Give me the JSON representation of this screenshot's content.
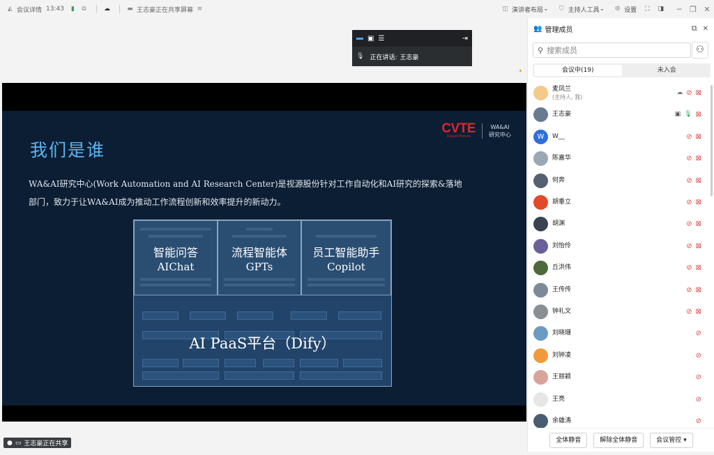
{
  "topbar": {
    "app": "会议详情",
    "time": "13:43",
    "sharing_notice": "王志豪正在共享屏幕",
    "presenter_layout": "演讲者布局",
    "host_tools": "主持人工具",
    "settings": "设置"
  },
  "speaker": {
    "label": "正在讲话:",
    "name": "王志豪"
  },
  "slide": {
    "title": "我们是谁",
    "desc1": "WA&AI研究中心(Work Automation and AI Research Center)是视源股份针对工作自动化和AI研究的探索&落地",
    "desc2": "部门，致力于让WA&AI成为推动工作流程创新和效率提升的新动力。",
    "logo_main": "CVTE",
    "logo_sub": "Dream·Future",
    "logo_r1": "WA&AI",
    "logo_r2": "研究中心",
    "cells": [
      {
        "cn": "智能问答",
        "en": "AIChat"
      },
      {
        "cn": "流程智能体",
        "en": "GPTs"
      },
      {
        "cn": "员工智能助手",
        "en": "Copilot"
      }
    ],
    "paas": "AI PaaS平台（Dify）"
  },
  "status": {
    "sharing": "王志豪正在共享"
  },
  "panel": {
    "title": "管理成员",
    "search_placeholder": "搜索成员",
    "tab_in": "会议中(19)",
    "tab_out": "未入会",
    "members": [
      {
        "name": "麦凤兰",
        "sub": "(主持人, 我)",
        "color": "#f4c98a"
      },
      {
        "name": "王志豪",
        "sub": "",
        "color": "#6a7a90"
      },
      {
        "name": "W__",
        "sub": "",
        "color": "#2f6fdc",
        "letter": "W"
      },
      {
        "name": "陈嘉华",
        "sub": "",
        "color": "#9aa7b5"
      },
      {
        "name": "何奔",
        "sub": "",
        "color": "#556070"
      },
      {
        "name": "胡垂立",
        "sub": "",
        "color": "#e24a2a"
      },
      {
        "name": "胡渊",
        "sub": "",
        "color": "#3a4250"
      },
      {
        "name": "刘怡伶",
        "sub": "",
        "color": "#6b5f9a"
      },
      {
        "name": "丘洪伟",
        "sub": "",
        "color": "#4e6a3c"
      },
      {
        "name": "王传传",
        "sub": "",
        "color": "#7b8a99"
      },
      {
        "name": "钟礼文",
        "sub": "",
        "color": "#8a8f96"
      },
      {
        "name": "刘晓珊",
        "sub": "",
        "color": "#6b9bc2"
      },
      {
        "name": "刘钟凌",
        "sub": "",
        "color": "#f09a3c"
      },
      {
        "name": "王丽颖",
        "sub": "",
        "color": "#d8a49a"
      },
      {
        "name": "王亮",
        "sub": "",
        "color": "#e6e6e6"
      },
      {
        "name": "余雄涛",
        "sub": "",
        "color": "#4a5c70"
      }
    ],
    "btn_mute_all": "全体静音",
    "btn_unmute_all": "解除全体静音",
    "btn_control": "会议管控"
  }
}
